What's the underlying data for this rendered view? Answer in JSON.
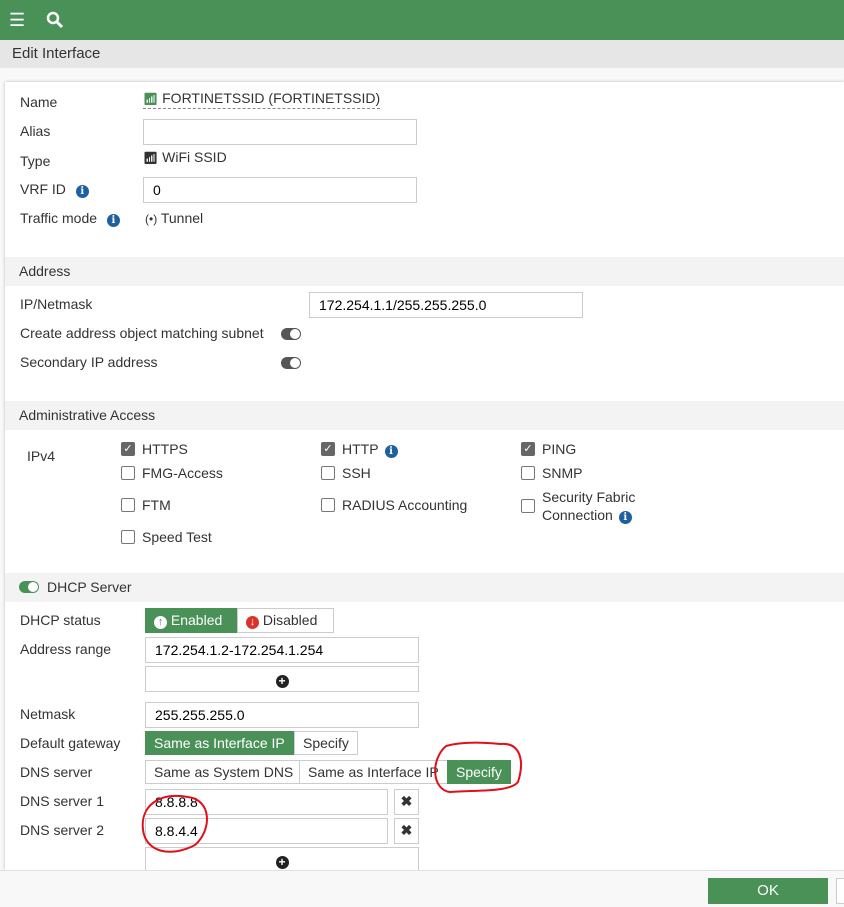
{
  "header": {
    "title": "Edit Interface"
  },
  "general": {
    "name_label": "Name",
    "name_value": "FORTINETSSID (FORTINETSSID)",
    "alias_label": "Alias",
    "alias_value": "",
    "type_label": "Type",
    "type_value": "WiFi SSID",
    "vrf_label": "VRF ID",
    "vrf_value": "0",
    "traffic_label": "Traffic mode",
    "traffic_value": "Tunnel"
  },
  "address": {
    "title": "Address",
    "ip_label": "IP/Netmask",
    "ip_value": "172.254.1.1/255.255.255.0",
    "create_obj_label": "Create address object matching subnet",
    "secondary_label": "Secondary IP address"
  },
  "admin": {
    "title": "Administrative Access",
    "ipv4_label": "IPv4",
    "options": [
      {
        "label": "HTTPS",
        "checked": true
      },
      {
        "label": "HTTP",
        "checked": true
      },
      {
        "label": "PING",
        "checked": true
      },
      {
        "label": "FMG-Access",
        "checked": false
      },
      {
        "label": "SSH",
        "checked": false
      },
      {
        "label": "SNMP",
        "checked": false
      },
      {
        "label": "FTM",
        "checked": false
      },
      {
        "label": "RADIUS Accounting",
        "checked": false
      },
      {
        "label": "Security Fabric",
        "label2": "Connection",
        "checked": false
      },
      {
        "label": "Speed Test",
        "checked": false
      }
    ]
  },
  "dhcp": {
    "title": "DHCP Server",
    "status_label": "DHCP status",
    "enabled": "Enabled",
    "disabled": "Disabled",
    "range_label": "Address range",
    "range_value": "172.254.1.2-172.254.1.254",
    "netmask_label": "Netmask",
    "netmask_value": "255.255.255.0",
    "gateway_label": "Default gateway",
    "gw_same": "Same as Interface IP",
    "gw_specify": "Specify",
    "dns_label": "DNS server",
    "dns_system": "Same as System DNS",
    "dns_iface": "Same as Interface IP",
    "dns_specify": "Specify",
    "dns1_label": "DNS server 1",
    "dns1_value": "8.8.8.8",
    "dns2_label": "DNS server 2",
    "dns2_value": "8.8.4.4"
  },
  "footer": {
    "ok": "OK"
  },
  "colors": {
    "brand": "#4a9158",
    "annotation": "#e0101a"
  }
}
